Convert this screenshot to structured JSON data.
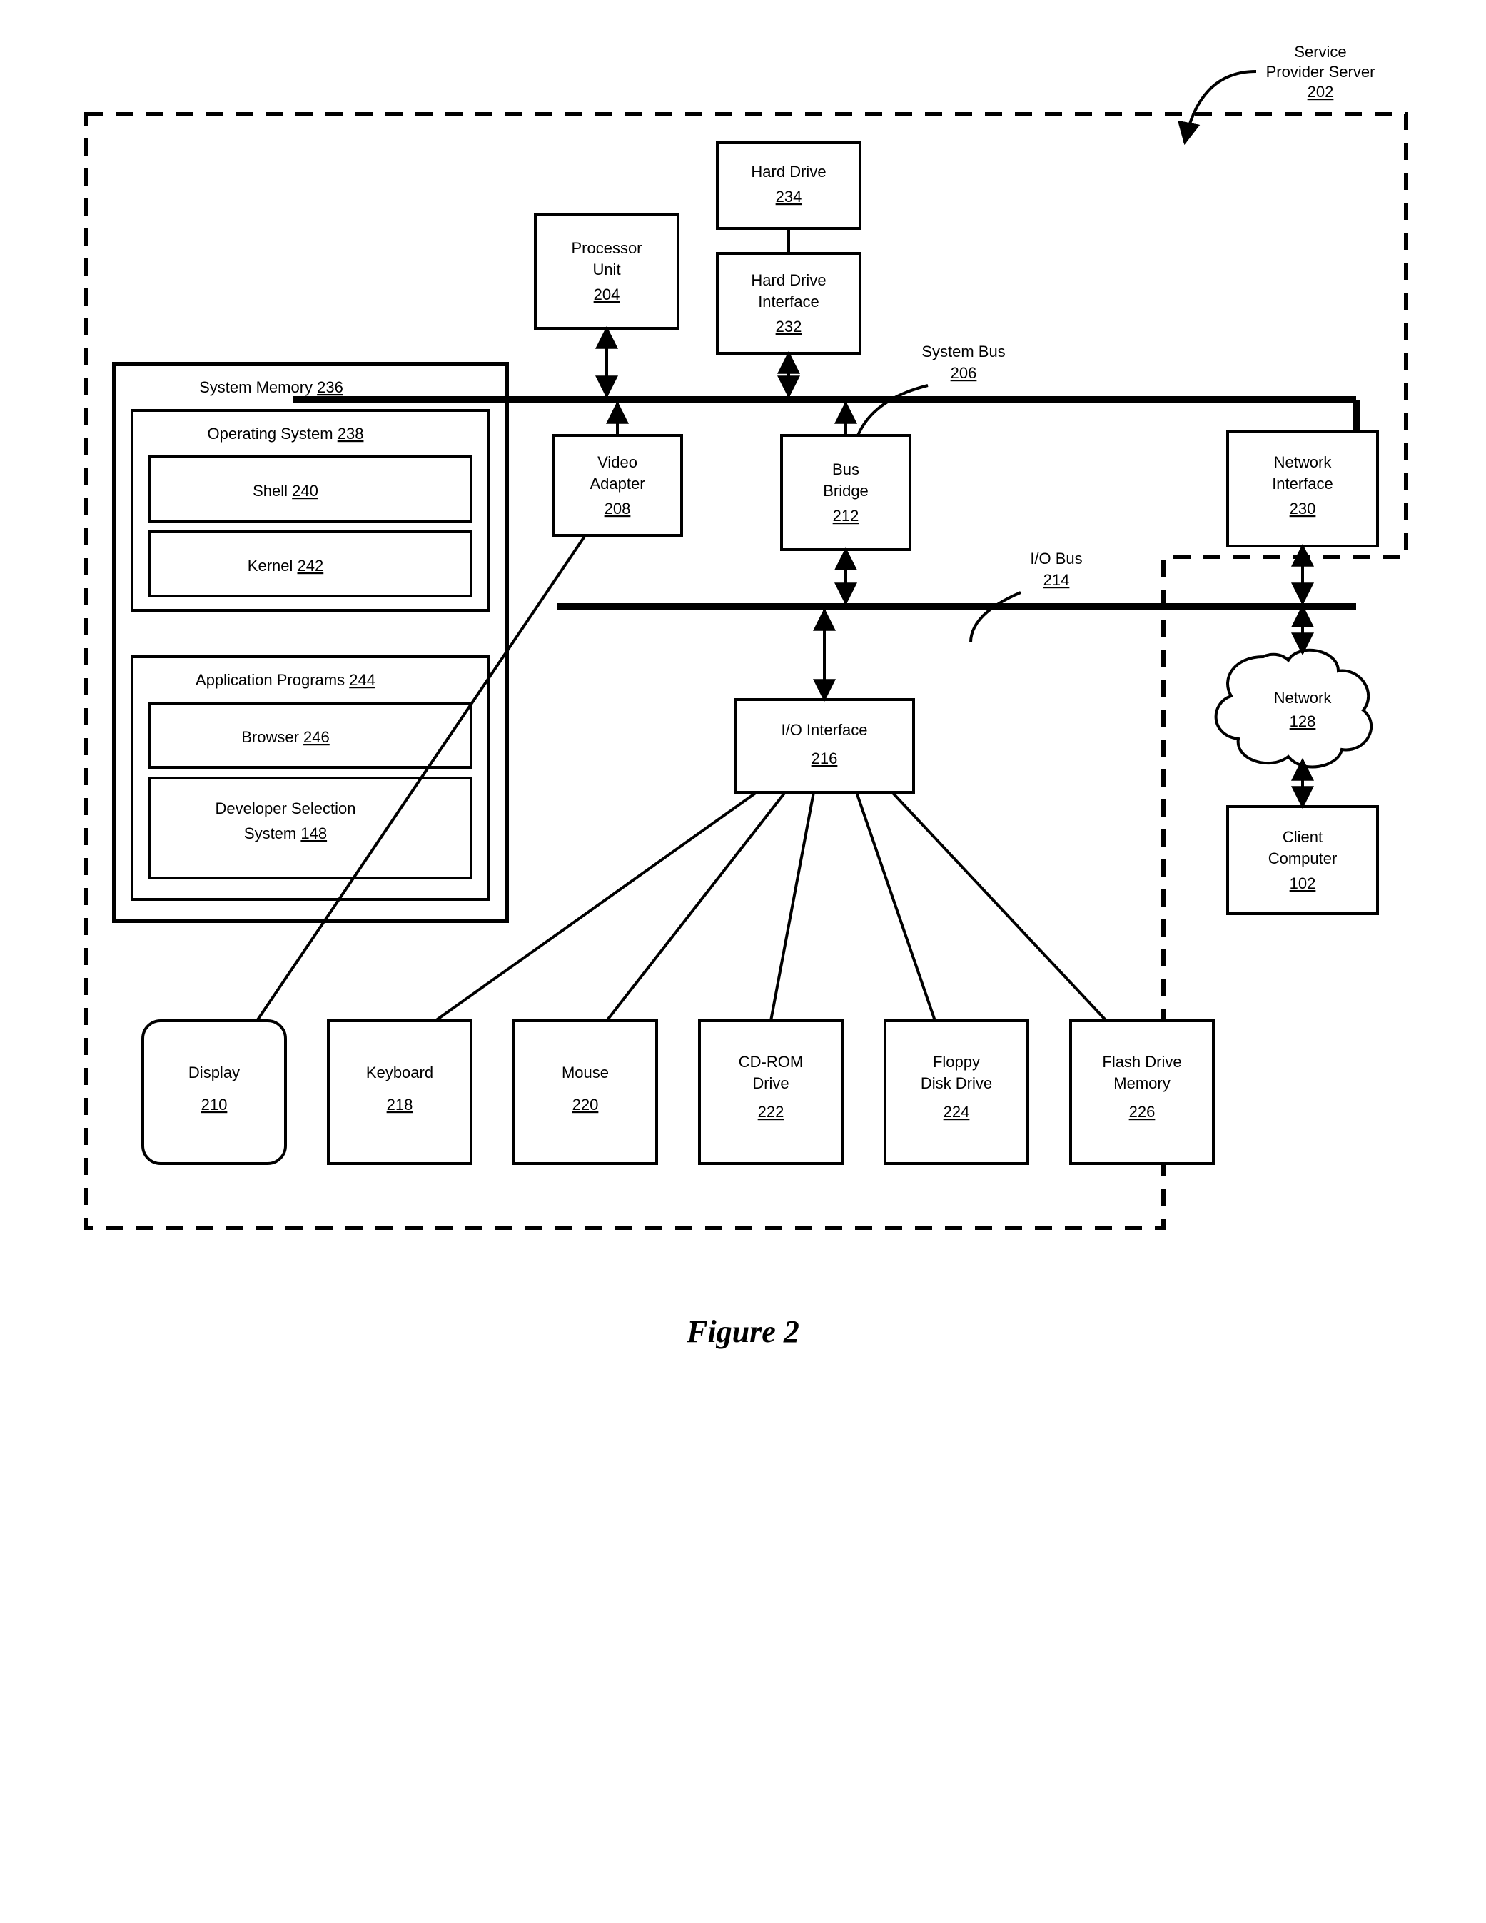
{
  "title": {
    "label": "Figure 2"
  },
  "server": {
    "label1": "Service",
    "label2": "Provider Server",
    "num": "202"
  },
  "processor": {
    "label1": "Processor",
    "label2": "Unit",
    "num": "204"
  },
  "hdd": {
    "label": "Hard Drive",
    "num": "234"
  },
  "hddif": {
    "label1": "Hard Drive",
    "label2": "Interface",
    "num": "232"
  },
  "video": {
    "label1": "Video",
    "label2": "Adapter",
    "num": "208"
  },
  "busbridge": {
    "label1": "Bus",
    "label2": "Bridge",
    "num": "212"
  },
  "netif": {
    "label1": "Network",
    "label2": "Interface",
    "num": "230"
  },
  "ioif": {
    "label": "I/O Interface",
    "num": "216"
  },
  "sysbus": {
    "label": "System Bus",
    "num": "206"
  },
  "iobus": {
    "label": "I/O Bus",
    "num": "214"
  },
  "display": {
    "label": "Display",
    "num": "210"
  },
  "keyboard": {
    "label": "Keyboard",
    "num": "218"
  },
  "mouse": {
    "label": "Mouse",
    "num": "220"
  },
  "cdrom": {
    "label1": "CD-ROM",
    "label2": "Drive",
    "num": "222"
  },
  "floppy": {
    "label1": "Floppy",
    "label2": "Disk Drive",
    "num": "224"
  },
  "flash": {
    "label1": "Flash Drive",
    "label2": "Memory",
    "num": "226"
  },
  "network": {
    "label": "Network",
    "num": "128"
  },
  "client": {
    "label1": "Client",
    "label2": "Computer",
    "num": "102"
  },
  "sysmem": {
    "label": "System Memory",
    "num": "236"
  },
  "os": {
    "label": "Operating System",
    "num": "238"
  },
  "shell": {
    "label": "Shell",
    "num": "240"
  },
  "kernel": {
    "label": "Kernel",
    "num": "242"
  },
  "apps": {
    "label": "Application Programs",
    "num": "244"
  },
  "browser": {
    "label": "Browser",
    "num": "246"
  },
  "devsel": {
    "label1": "Developer Selection",
    "label2": "System",
    "num": "148"
  }
}
